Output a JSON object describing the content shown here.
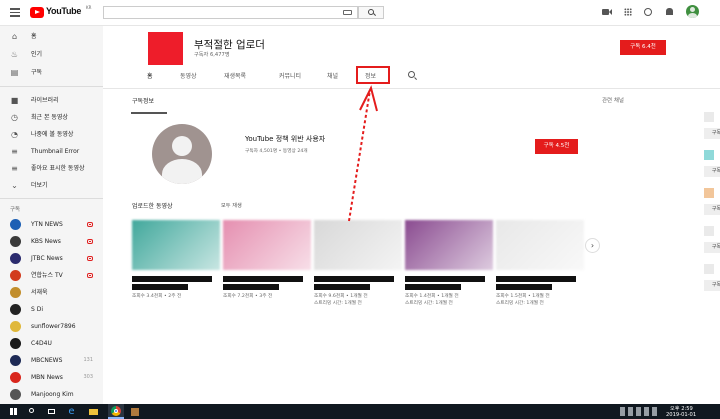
{
  "header": {
    "logo_text": "YouTube",
    "logo_region": "KR",
    "search_placeholder": "",
    "icons": [
      "video-camera-icon",
      "apps-grid-icon",
      "chat-icon",
      "bell-icon",
      "account-avatar"
    ]
  },
  "sidebar": {
    "nav": [
      {
        "label": "홈",
        "icon": "home-icon"
      },
      {
        "label": "인기",
        "icon": "flame-icon"
      },
      {
        "label": "구독",
        "icon": "subscriptions-icon"
      }
    ],
    "library": [
      {
        "label": "라이브러리",
        "icon": "folder-icon"
      },
      {
        "label": "최근 본 동영상",
        "icon": "history-icon"
      },
      {
        "label": "나중에 볼 동영상",
        "icon": "clock-icon"
      },
      {
        "label": "Thumbnail Error",
        "icon": "playlist-icon"
      },
      {
        "label": "좋아요 표시한 동영상",
        "icon": "playlist-icon"
      },
      {
        "label": "더보기",
        "icon": "chevron-down-icon"
      }
    ],
    "subscriptions_title": "구독",
    "subscriptions": [
      {
        "name": "YTN NEWS",
        "badge": "live",
        "color": "#1c5fb4"
      },
      {
        "name": "KBS News",
        "badge": "live",
        "color": "#3a3a3a"
      },
      {
        "name": "JTBC News",
        "badge": "live",
        "color": "#2b2b6e"
      },
      {
        "name": "연합뉴스 TV",
        "badge": "live",
        "color": "#d23b1e"
      },
      {
        "name": "서재욱",
        "badge": "",
        "color": "#c28e2c"
      },
      {
        "name": "S Di",
        "badge": "",
        "color": "#222222"
      },
      {
        "name": "sunflower7896",
        "badge": "",
        "color": "#e0b83a"
      },
      {
        "name": "C4D4U",
        "badge": "",
        "color": "#1a1a1a"
      },
      {
        "name": "MBCNEWS",
        "badge": "131",
        "color": "#1d2a55"
      },
      {
        "name": "MBN News",
        "badge": "303",
        "color": "#d9261c"
      },
      {
        "name": "Manjoong Kim",
        "badge": "",
        "color": "#555555"
      }
    ]
  },
  "channel": {
    "name": "부적절한 업로더",
    "subscribers": "구독자 6,477명",
    "subscribe_label": "구독 6.4천",
    "tabs": [
      "홈",
      "동영상",
      "재생목록",
      "커뮤니티",
      "채널",
      "정보"
    ],
    "active_tab": "홈",
    "highlighted_tab": "정보"
  },
  "featured": {
    "section_title": "구독정보",
    "name": "YouTube 정책 위반 사용자",
    "meta": "구독자 4,501명 • 동영상 24개",
    "subscribe_label": "구독 4.5천"
  },
  "uploads": {
    "title": "업로드한 동영상",
    "play_all": "모두 재생",
    "videos": [
      {
        "line1": "조회수 3.4천회 • 2주 전",
        "line2": "",
        "thumb": "#41a89c"
      },
      {
        "line1": "조회수 7.2천회 • 3주 전",
        "line2": "",
        "thumb": "#e58fb0"
      },
      {
        "line1": "조회수 9.6천회 • 1개월 전",
        "line2": "스트리밍 시간: 1개월 전",
        "thumb": "#d8d8d8"
      },
      {
        "line1": "조회수 1.4천회 • 1개월 전",
        "line2": "스트리밍 시간: 1개월 전",
        "thumb": "#8a4b90"
      },
      {
        "line1": "조회수 1.5천회 • 1개월 전",
        "line2": "스트리밍 시간: 1개월 전",
        "thumb": "#e8e8e8"
      }
    ]
  },
  "related": {
    "title": "관련 채널",
    "subscribe_label": "구독",
    "thumbs": [
      "#eaeaea",
      "#8fd9d9",
      "#f2c69a",
      "#eaeaea",
      "#eaeaea"
    ]
  },
  "taskbar": {
    "time": "오후 2:59",
    "date": "2019-01-01"
  },
  "colors": {
    "accent": "#e41c1c",
    "annotation": "#e41c1c"
  }
}
